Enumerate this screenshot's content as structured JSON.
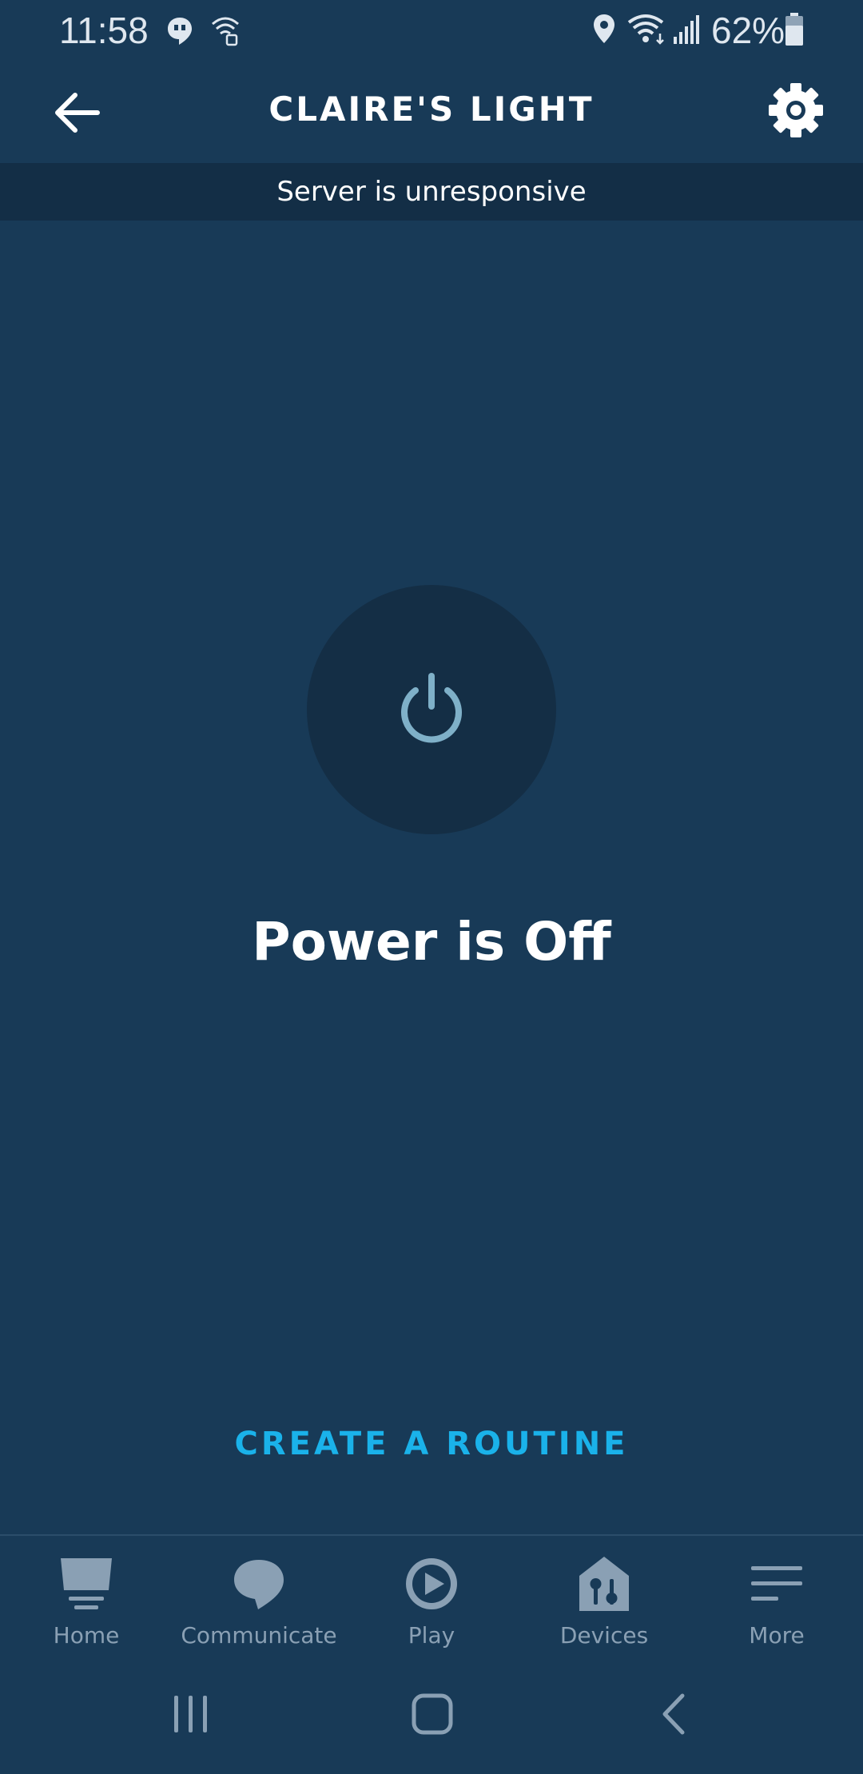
{
  "status_bar": {
    "time": "11:58",
    "battery": "62%"
  },
  "header": {
    "title": "CLAIRE'S LIGHT"
  },
  "banner": {
    "message": "Server is unresponsive"
  },
  "device": {
    "power_status": "Power is Off"
  },
  "actions": {
    "create_routine": "CREATE A ROUTINE"
  },
  "bottom_nav": {
    "items": [
      {
        "label": "Home",
        "icon": "home-icon"
      },
      {
        "label": "Communicate",
        "icon": "chat-bubble-icon"
      },
      {
        "label": "Play",
        "icon": "play-icon"
      },
      {
        "label": "Devices",
        "icon": "devices-icon"
      },
      {
        "label": "More",
        "icon": "menu-icon"
      }
    ]
  },
  "colors": {
    "background": "#183a57",
    "banner": "#132e46",
    "accent": "#1ab2ea",
    "power_icon": "#7fb0c8",
    "nav_inactive": "#8aa0b4"
  }
}
